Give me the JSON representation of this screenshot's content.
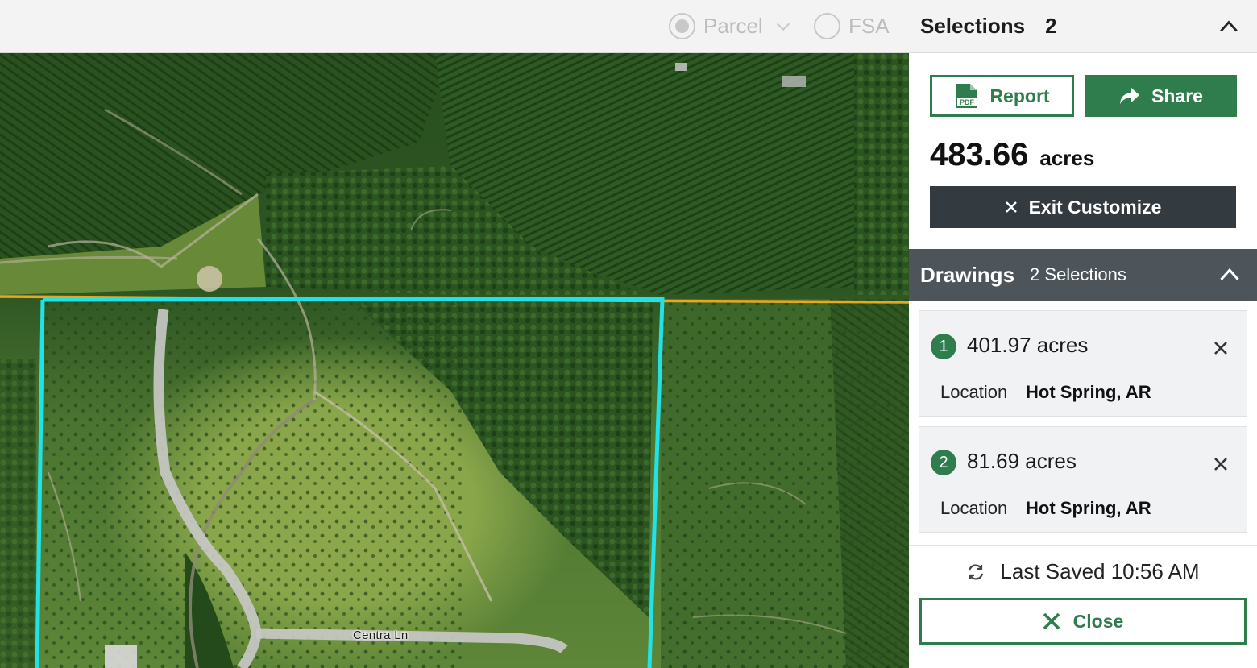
{
  "map": {
    "road_label": "Centra Ln",
    "colors": {
      "selection_outline": "#1fe3e8",
      "boundary_line": "#e8a81e"
    }
  },
  "toolbar": {
    "layers": [
      {
        "label": "Parcel",
        "selected": true,
        "icon": "chevron-down-icon"
      },
      {
        "label": "FSA",
        "selected": false
      }
    ]
  },
  "selections": {
    "title": "Selections",
    "count": "2",
    "report_label": "Report",
    "share_label": "Share",
    "total_acres": "483.66",
    "total_unit": "acres",
    "exit_label": "Exit Customize"
  },
  "drawings": {
    "title": "Drawings",
    "count_label": "2 Selections",
    "items": [
      {
        "index": "1",
        "acres": "401.97 acres",
        "location_label": "Location",
        "location": "Hot Spring, AR"
      },
      {
        "index": "2",
        "acres": "81.69 acres",
        "location_label": "Location",
        "location": "Hot Spring, AR"
      }
    ]
  },
  "footer": {
    "last_saved": "Last Saved 10:56 AM",
    "close_label": "Close"
  },
  "colors": {
    "brand_green": "#2f7d4d",
    "dark_button": "#333b41",
    "drawings_header": "#4d555b"
  }
}
